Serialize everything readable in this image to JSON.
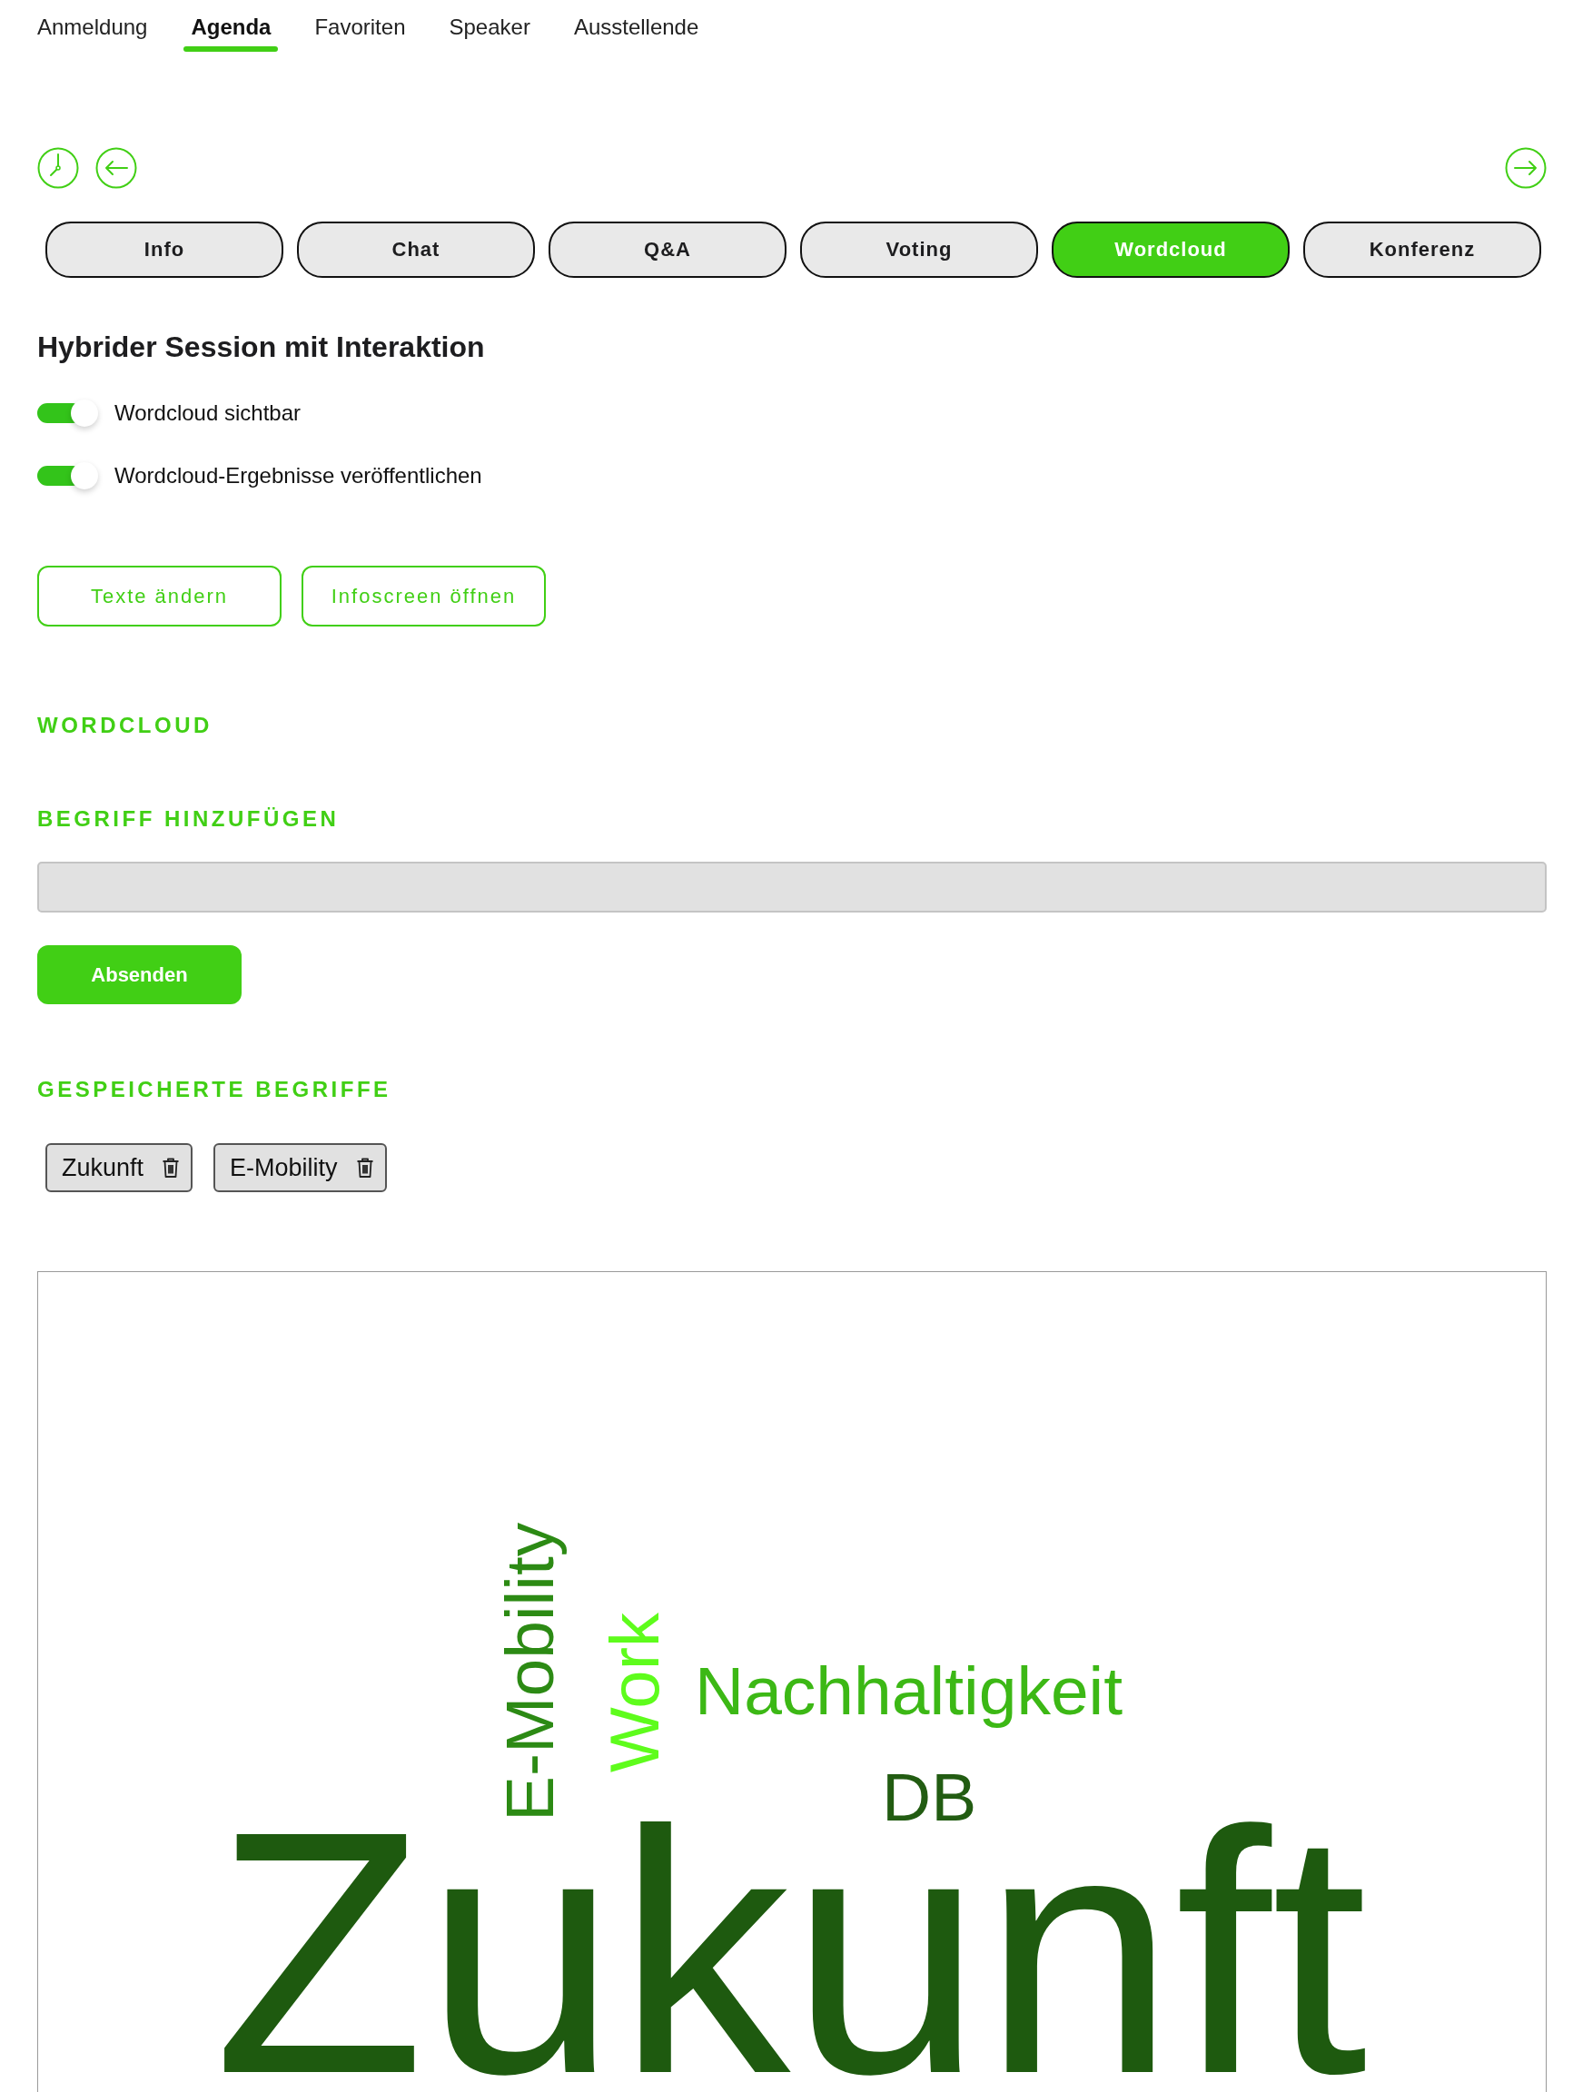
{
  "nav": {
    "items": [
      {
        "label": "Anmeldung",
        "selected": false
      },
      {
        "label": "Agenda",
        "selected": true
      },
      {
        "label": "Favoriten",
        "selected": false
      },
      {
        "label": "Speaker",
        "selected": false
      },
      {
        "label": "Ausstellende",
        "selected": false
      }
    ]
  },
  "session_tabs": [
    {
      "label": "Info",
      "selected": false
    },
    {
      "label": "Chat",
      "selected": false
    },
    {
      "label": "Q&A",
      "selected": false
    },
    {
      "label": "Voting",
      "selected": false
    },
    {
      "label": "Wordcloud",
      "selected": true
    },
    {
      "label": "Konferenz",
      "selected": false
    }
  ],
  "session": {
    "title": "Hybrider Session mit Interaktion",
    "toggles": [
      {
        "label": "Wordcloud sichtbar",
        "on": true
      },
      {
        "label": "Wordcloud-Ergebnisse veröffentlichen",
        "on": true
      }
    ],
    "buttons": [
      "Texte ändern",
      "Infoscreen öffnen"
    ]
  },
  "wordcloud": {
    "heading": "WORDCLOUD",
    "add_heading": "BEGRIFF HINZUFÜGEN",
    "submit_button": "Absenden",
    "saved_heading": "GESPEICHERTE BEGRIFFE",
    "saved_terms": [
      "Zukunft",
      "E-Mobility"
    ],
    "cloud": {
      "words": [
        {
          "text": "E-Mobility",
          "color": "#2c8a14",
          "vertical": true
        },
        {
          "text": "Work",
          "color": "#5efc1c",
          "vertical": true
        },
        {
          "text": "Nachhaltigkeit",
          "color": "#3cb815",
          "vertical": false
        },
        {
          "text": "DB",
          "color": "#225c12",
          "vertical": false
        },
        {
          "text": "Zukunft",
          "color": "#1e5a0f",
          "vertical": false
        }
      ]
    }
  }
}
